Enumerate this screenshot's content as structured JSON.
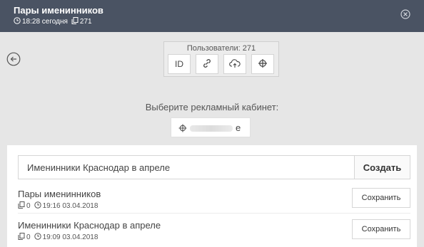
{
  "header": {
    "title": "Пары именинников",
    "time": "18:28 сегодня",
    "count": "271",
    "icons": [
      "clock-icon",
      "copy-icon",
      "close-icon"
    ]
  },
  "users": {
    "label": "Пользователи: 271",
    "buttons": [
      "ID",
      "link-icon",
      "cloud-upload-icon",
      "crosshair-icon"
    ]
  },
  "cabinet": {
    "title": "Выберите рекламный кабинет:",
    "suffix": "e"
  },
  "create": {
    "input_value": "Именинники Краснодар в апреле",
    "button_label": "Создать"
  },
  "items": [
    {
      "name": "Пары именинников",
      "count": "0",
      "time": "19:16 03.04.2018",
      "save_label": "Сохранить"
    },
    {
      "name": "Именинники Краснодар в апреле",
      "count": "0",
      "time": "19:09 03.04.2018",
      "save_label": "Сохранить"
    }
  ]
}
